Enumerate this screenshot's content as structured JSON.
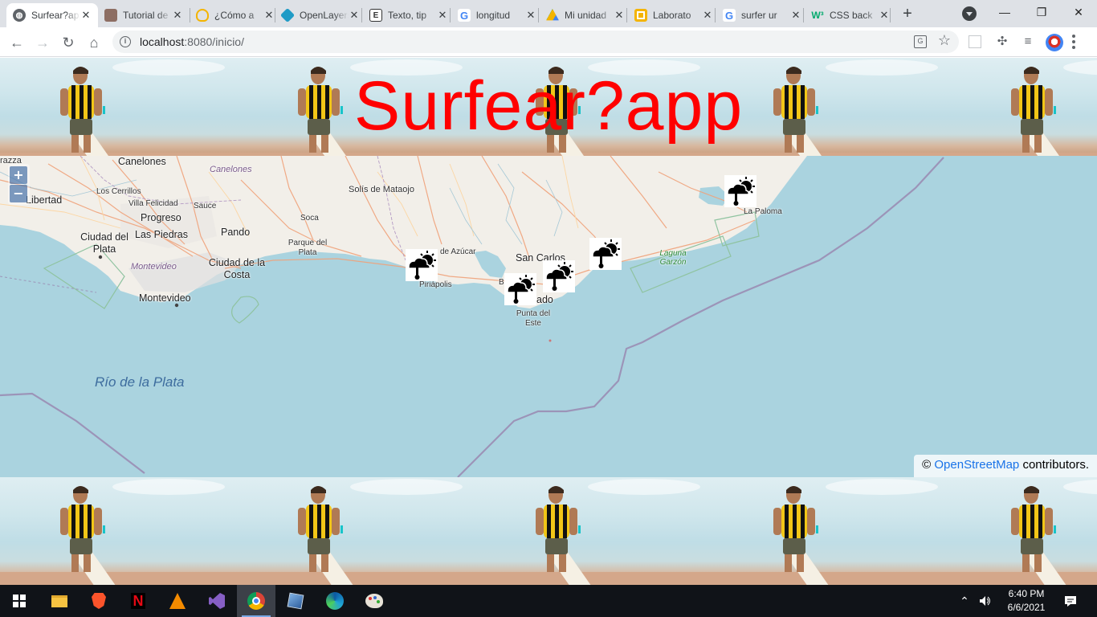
{
  "browser": {
    "tabs": [
      {
        "title": "Surfear?app",
        "favicon": "globe-icon",
        "active": true
      },
      {
        "title": "Tutorial de",
        "favicon": "avatar-icon",
        "active": false
      },
      {
        "title": "¿Cómo a",
        "favicon": "lightbulb-icon",
        "active": false
      },
      {
        "title": "OpenLayers",
        "favicon": "openlayers-icon",
        "active": false
      },
      {
        "title": "Texto, tip",
        "favicon": "e-icon",
        "active": false
      },
      {
        "title": "longitud",
        "favicon": "google-icon",
        "active": false
      },
      {
        "title": "Mi unidad",
        "favicon": "drive-icon",
        "active": false
      },
      {
        "title": "Laborato",
        "favicon": "slides-icon",
        "active": false
      },
      {
        "title": "surfer ur",
        "favicon": "google-icon",
        "active": false
      },
      {
        "title": "CSS back",
        "favicon": "w3-icon",
        "active": false
      }
    ],
    "close_glyph": "✕",
    "new_tab_glyph": "+",
    "window_controls": {
      "minimize": "—",
      "restore": "❐",
      "close": "✕"
    },
    "url": {
      "host": "localhost",
      "rest": ":8080/inicio/"
    }
  },
  "page": {
    "title": "Surfear?app",
    "title_color": "#ff0000",
    "background_tiles": 5
  },
  "map": {
    "zoom_in": "+",
    "zoom_out": "−",
    "attribution": {
      "prefix": "©",
      "link": "OpenStreetMap",
      "suffix": "contributors."
    },
    "labels": {
      "canelones_city": "Canelones",
      "canelones_dept": "Canelones",
      "los_cerrillos": "Los Cerrillos",
      "villa_felicidad": "Villa Felicidad",
      "progreso": "Progreso",
      "sauce": "Sauce",
      "las_piedras": "Las Piedras",
      "pando": "Pando",
      "soca": "Soca",
      "solis": "Solís de Mataojo",
      "libertad": "Libertad",
      "ciudad_del_plata": "Ciudad del Plata",
      "montevideo_dept": "Montevideo",
      "ciudad_de_la_costa": "Ciudad de la Costa",
      "parque_del_plata": "Parque del Plata",
      "montevideo": "Montevideo",
      "rio_de_la_plata": "Río de la Plata",
      "pan_de_azucar": "de Azúcar",
      "piriapolis": "Piriápolis",
      "san_carlos": "San Carlos",
      "maldonado": "ado",
      "punta_del_este": "Punta del Este",
      "la_paloma": "La Paloma",
      "laguna_garzon": "Laguna Garzón",
      "raza": "razza",
      "b": "B"
    },
    "markers": [
      {
        "name": "piriapolis",
        "icon": "weather-icon"
      },
      {
        "name": "punta-del-este",
        "icon": "weather-icon"
      },
      {
        "name": "manantiales",
        "icon": "weather-icon"
      },
      {
        "name": "jose-ignacio",
        "icon": "weather-icon"
      },
      {
        "name": "la-paloma",
        "icon": "weather-icon"
      }
    ]
  },
  "taskbar": {
    "apps": [
      "file-explorer-icon",
      "brave-icon",
      "netflix-icon",
      "vlc-icon",
      "visual-studio-icon",
      "chrome-icon",
      "virtualbox-icon",
      "edge-icon",
      "paint-icon"
    ],
    "time": "6:40 PM",
    "date": "6/6/2021"
  }
}
